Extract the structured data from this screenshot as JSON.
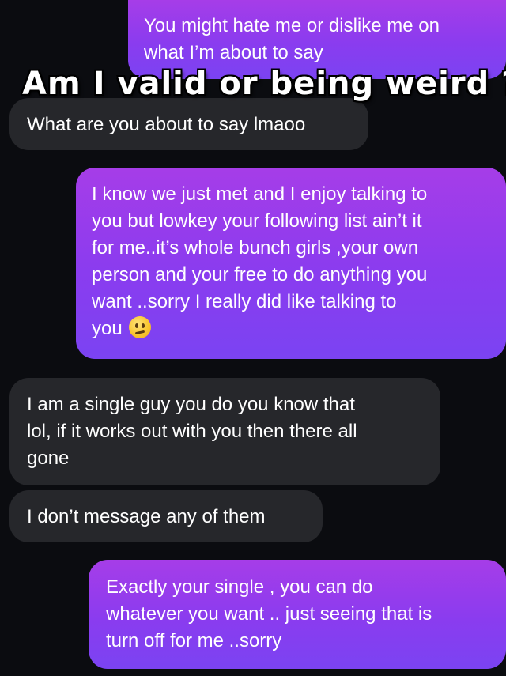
{
  "overlay": {
    "title": "Am I valid or being weird ?"
  },
  "messages": [
    {
      "sender": "me",
      "lines": [
        "You might hate me or dislike me on",
        "what I’m about to say"
      ]
    },
    {
      "sender": "them",
      "lines": [
        "What are you about to say lmaoo"
      ]
    },
    {
      "sender": "me",
      "lines": [
        "I know we just met and I enjoy talking to",
        "you but lowkey your following list ain’t it",
        "for me..it’s whole bunch girls  ,your own",
        "person and your free to do anything you",
        "want ..sorry I really did like talking to",
        "you"
      ],
      "emoji": "confused-face"
    },
    {
      "sender": "them",
      "lines": [
        "I am a single guy you do you know that",
        "lol, if it works out with you then there all",
        "gone"
      ]
    },
    {
      "sender": "them",
      "lines": [
        "I don’t message any of them"
      ]
    },
    {
      "sender": "me",
      "lines": [
        "Exactly your single , you can do",
        "whatever you want .. just seeing that is",
        "turn off for me ..sorry"
      ]
    }
  ],
  "colors": {
    "background": "#0b0c10",
    "sent_bubble": "#8a3cef",
    "received_bubble": "#26272b"
  }
}
